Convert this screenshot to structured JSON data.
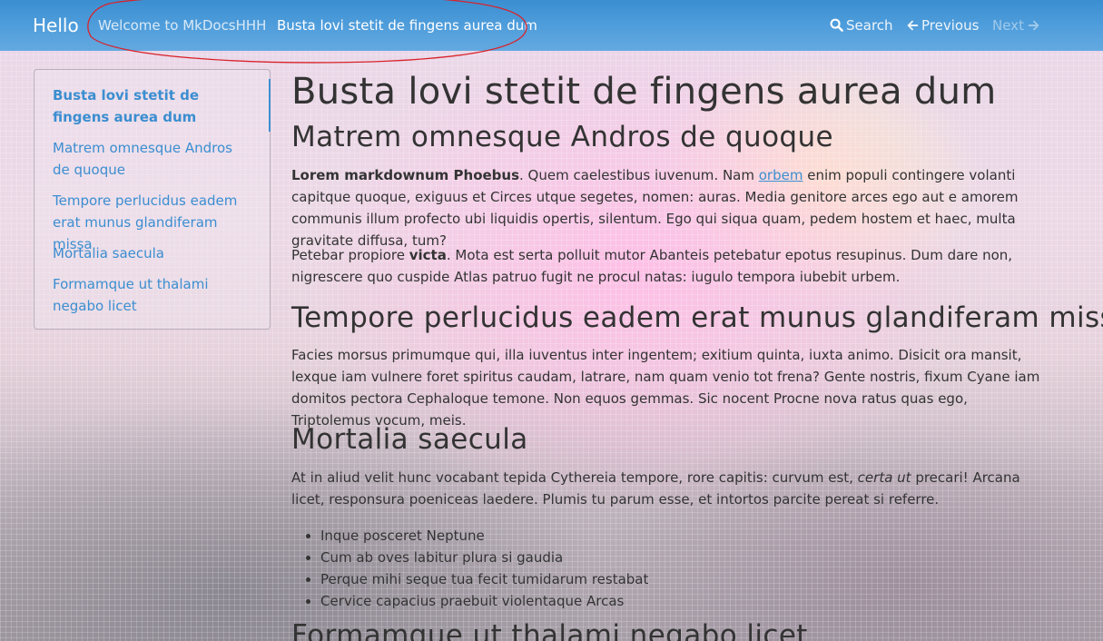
{
  "navbar": {
    "brand": "Hello",
    "links": [
      {
        "label": "Welcome to MkDocsHHH"
      },
      {
        "label": "Busta lovi stetit de fingens aurea dum"
      }
    ],
    "search_label": "Search",
    "previous_label": "Previous",
    "next_label": "Next"
  },
  "sidebar": {
    "items": [
      {
        "label": "Busta lovi stetit de fingens aurea dum"
      },
      {
        "label": "Matrem omnesque Andros de quoque"
      },
      {
        "label": "Tempore perlucidus eadem erat munus glandiferam missa"
      },
      {
        "label": "Mortalia saecula"
      },
      {
        "label": "Formamque ut thalami negabo licet"
      }
    ]
  },
  "main": {
    "title": "Busta lovi stetit de fingens aurea dum",
    "sections": [
      {
        "heading": "Matrem omnesque Andros de quoque"
      },
      {
        "heading": "Tempore perlucidus eadem erat munus glandiferam missa"
      },
      {
        "heading": "Mortalia saecula"
      },
      {
        "heading": "Formamque ut thalami negabo licet"
      }
    ],
    "p1": {
      "bold": "Lorem markdownum Phoebus",
      "text_a": ". Quem caelestibus iuvenum. Nam ",
      "link": "orbem",
      "text_b": " enim populi contingere volanti capitque quoque, exiguus et Circes utque segetes, nomen: auras. Media genitore arces ego aut e amorem communis illum profecto ubi liquidis opertis, silentum. Ego qui siqua quam, pedem hostem et haec, multa gravitate diffusa, tum?"
    },
    "p2": {
      "text_a": "Petebar propiore ",
      "bold": "victa",
      "text_b": ". Mota est serta polluit mutor Abanteis petebatur epotus resupinus. Dum dare non, nigrescere quo cuspide Atlas patruo fugit ne procul natas: iugulo tempora iubebit urbem."
    },
    "p3": "Facies morsus primumque qui, illa iuventus inter ingentem; exitium quinta, iuxta animo. Disicit ora mansit, lexque iam vulnere foret spiritus caudam, latrare, nam quam venio tot frena? Gente nostris, fixum Cyane iam domitos pectora Cephaloque temone. Non equos gemmas. Sic nocent Procne nova ratus quas ego, Triptolemus vocum, meis.",
    "p4": {
      "text_a": "At in aliud velit hunc vocabant tepida Cythereia tempore, rore capitis: curvum est, ",
      "italic": "certa ut",
      "text_b": " precari! Arcana licet, responsura poeniceas laedere. Plumis tu parum esse, et intortos parcite pereat si referre."
    },
    "bullets": [
      {
        "text": "Inque posceret Neptune"
      },
      {
        "text": "Cum ab oves labitur plura si gaudia"
      },
      {
        "text": "Perque mihi seque tua fecit tumidarum restabat"
      },
      {
        "text": "Cervice capacius praebuit violentaque Arcas"
      }
    ]
  },
  "icons": {
    "search": "search-icon",
    "previous": "arrow-left-icon",
    "next": "arrow-right-icon"
  },
  "colors": {
    "navbar": "#4f9ddb",
    "link": "#3b8ed0",
    "annotation": "#d8232a"
  }
}
